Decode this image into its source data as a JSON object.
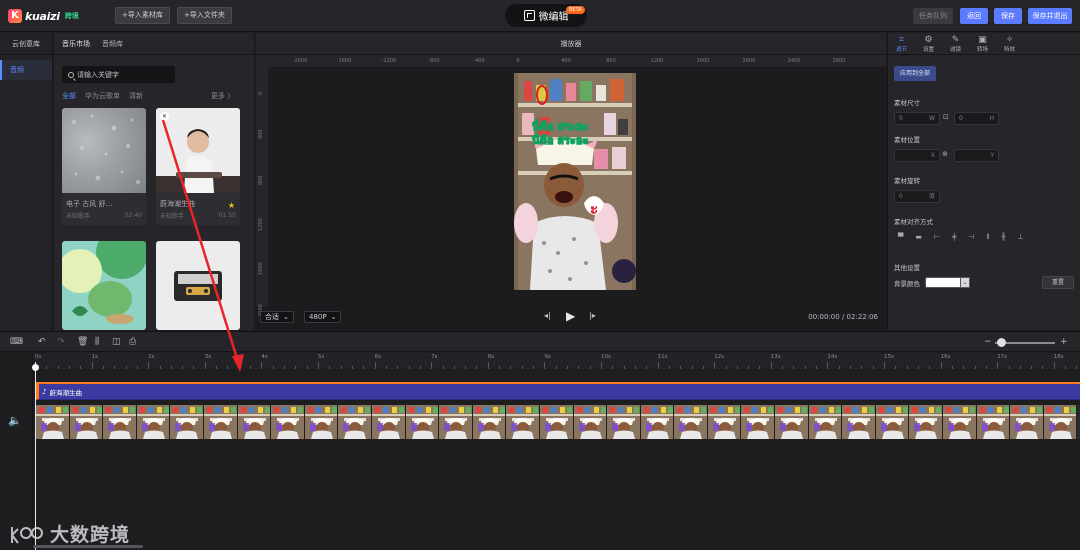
{
  "app": {
    "logo_text": "kuaizi",
    "logo_badge": "跨境",
    "title": "微编辑",
    "title_badge": "BETA"
  },
  "topbar": {
    "import_material": "+导入素材库",
    "import_folder": "+导入文件夹",
    "task_queue": "任务队列",
    "back": "返回",
    "save": "保存",
    "save_exit": "保存并退出"
  },
  "left_nav": {
    "header": "云创意库",
    "items": [
      {
        "label": "音频"
      }
    ]
  },
  "library": {
    "tabs": [
      "音乐市场",
      "音频库"
    ],
    "search_placeholder": "请输入关键字",
    "categories": [
      "全部",
      "华为云歌单",
      "清新"
    ],
    "more": "更多 〉",
    "cards": [
      {
        "name": "电子 古风 舒…",
        "artist": "未知歌手",
        "duration": "02:40"
      },
      {
        "name": "蔚海潮生曲",
        "artist": "未知歌手",
        "duration": "01:50"
      },
      {
        "name": "",
        "artist": "",
        "duration": ""
      },
      {
        "name": "",
        "artist": "",
        "duration": ""
      }
    ]
  },
  "player": {
    "title": "播放器",
    "ruler_h": [
      "-2000",
      "-1600",
      "-1200",
      "-800",
      "-400",
      "0",
      "400",
      "800",
      "1200",
      "1600",
      "2000",
      "2400",
      "2800"
    ],
    "ruler_v": [
      "0",
      "400",
      "800",
      "1200",
      "1600",
      "2000"
    ],
    "fit": "合适",
    "resolution": "480P",
    "time_current": "00:00:00",
    "time_total": "02:22:06",
    "overlay_text": "นี่คือ สระอะ"
  },
  "props": {
    "tabs": [
      "调节",
      "设置",
      "滤镜",
      "转场",
      "特效"
    ],
    "apply_all": "应用到全部",
    "size_label": "素材尺寸",
    "size_w": "0",
    "size_w_unit": "W",
    "size_h": "0",
    "size_h_unit": "H",
    "position_label": "素材位置",
    "pos_x_unit": "X",
    "pos_y_unit": "Y",
    "rotate_label": "素材旋转",
    "rotate_value": "0",
    "rotate_unit": "度",
    "align_label": "素材对齐方式",
    "bg_section": "其他设置",
    "bg_label": "背景颜色",
    "reset": "重置"
  },
  "timeline": {
    "ruler": [
      "0s",
      "1s",
      "2s",
      "3s",
      "4s",
      "5s",
      "6s",
      "7s",
      "8s",
      "9s",
      "10s",
      "11s",
      "12s",
      "13s",
      "14s",
      "15s",
      "16s",
      "17s",
      "18s"
    ],
    "audio_clip": "蔚海潮生曲",
    "watermark": "大数跨境"
  }
}
